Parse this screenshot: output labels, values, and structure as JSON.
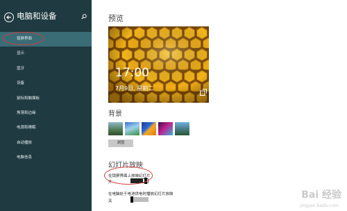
{
  "sidebar": {
    "title": "电脑和设备",
    "items": [
      {
        "label": "锁屏界面",
        "selected": true
      },
      {
        "label": "显示"
      },
      {
        "label": "蓝牙"
      },
      {
        "label": "设备"
      },
      {
        "label": "鼠标和触摸板"
      },
      {
        "label": "角落和边缘"
      },
      {
        "label": "电源和睡眠"
      },
      {
        "label": "自动播放"
      },
      {
        "label": "电脑信息"
      }
    ]
  },
  "main": {
    "preview_heading": "预览",
    "clock": "17:00",
    "date": "7月9日, 星期二",
    "background_heading": "背景",
    "browse_label": "浏览",
    "slideshow_heading": "幻灯片放映",
    "option1": {
      "label": "在锁屏界面上放映幻灯片",
      "state": "开",
      "on": true
    },
    "option2": {
      "label": "在电脑处于电池供电时播放幻灯片放映",
      "state": "关",
      "on": false
    }
  },
  "watermark": {
    "text": "Bai 经验",
    "sub": "jingyan.baidu.com"
  },
  "colors": {
    "sidebar_bg": "#1f3a41",
    "selected_bg": "#3a6c76",
    "highlight": "#d43a3a",
    "honeycomb": "#f2b51a"
  }
}
